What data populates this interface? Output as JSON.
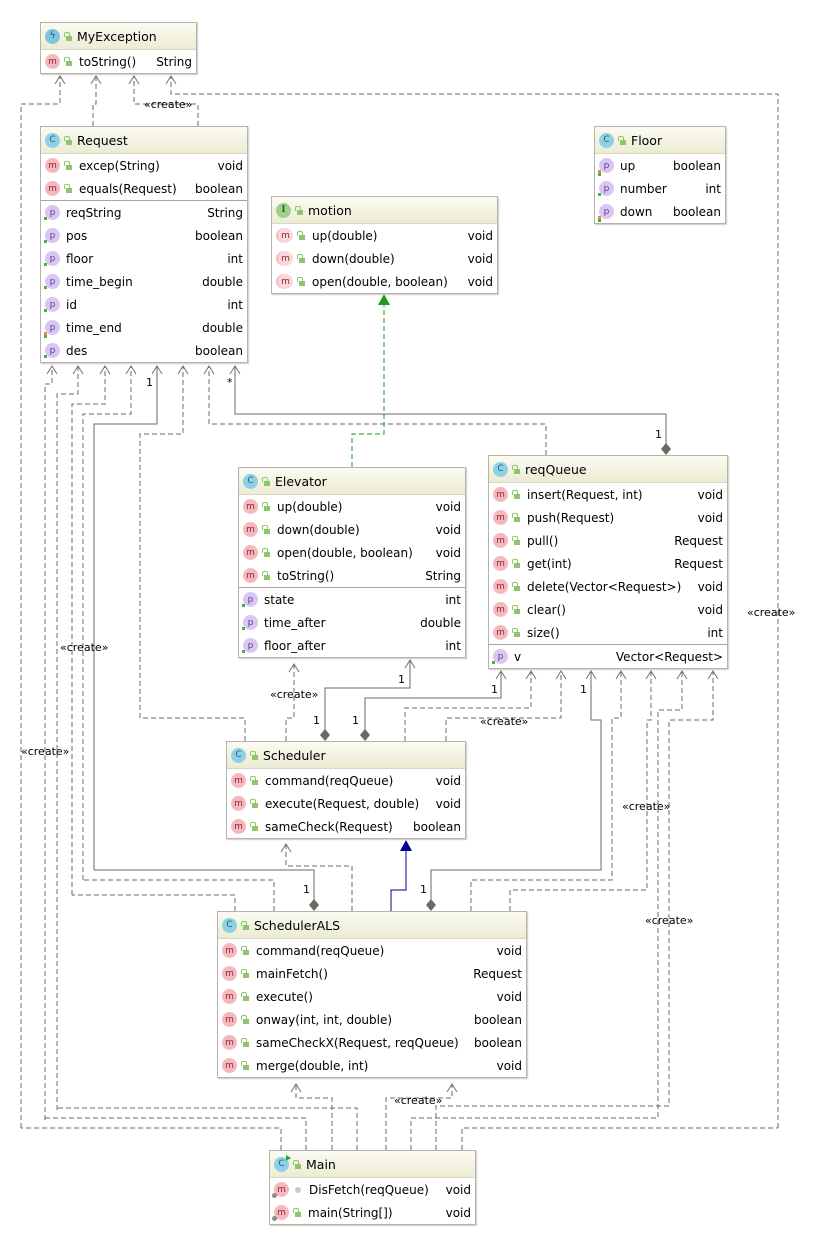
{
  "diagram": {
    "type": "UML class diagram",
    "classes": {
      "myexception": {
        "name": "MyException",
        "kind": "exception",
        "methods": [
          {
            "name": "toString()",
            "type": "String"
          }
        ]
      },
      "request": {
        "name": "Request",
        "kind": "class",
        "methods": [
          {
            "name": "excep(String)",
            "type": "void"
          },
          {
            "name": "equals(Request)",
            "type": "boolean"
          }
        ],
        "fields": [
          {
            "name": "reqString",
            "type": "String"
          },
          {
            "name": "pos",
            "type": "boolean"
          },
          {
            "name": "floor",
            "type": "int"
          },
          {
            "name": "time_begin",
            "type": "double"
          },
          {
            "name": "id",
            "type": "int"
          },
          {
            "name": "time_end",
            "type": "double"
          },
          {
            "name": "des",
            "type": "boolean"
          }
        ]
      },
      "floor": {
        "name": "Floor",
        "kind": "class",
        "fields": [
          {
            "name": "up",
            "type": "boolean"
          },
          {
            "name": "number",
            "type": "int"
          },
          {
            "name": "down",
            "type": "boolean"
          }
        ]
      },
      "motion": {
        "name": "motion",
        "kind": "interface",
        "methods": [
          {
            "name": "up(double)",
            "type": "void"
          },
          {
            "name": "down(double)",
            "type": "void"
          },
          {
            "name": "open(double, boolean)",
            "type": "void"
          }
        ]
      },
      "elevator": {
        "name": "Elevator",
        "kind": "class",
        "methods": [
          {
            "name": "up(double)",
            "type": "void"
          },
          {
            "name": "down(double)",
            "type": "void"
          },
          {
            "name": "open(double, boolean)",
            "type": "void"
          },
          {
            "name": "toString()",
            "type": "String"
          }
        ],
        "fields": [
          {
            "name": "state",
            "type": "int"
          },
          {
            "name": "time_after",
            "type": "double"
          },
          {
            "name": "floor_after",
            "type": "int"
          }
        ]
      },
      "reqqueue": {
        "name": "reqQueue",
        "kind": "class",
        "methods": [
          {
            "name": "insert(Request, int)",
            "type": "void"
          },
          {
            "name": "push(Request)",
            "type": "void"
          },
          {
            "name": "pull()",
            "type": "Request"
          },
          {
            "name": "get(int)",
            "type": "Request"
          },
          {
            "name": "delete(Vector<Request>)",
            "type": "void"
          },
          {
            "name": "clear()",
            "type": "void"
          },
          {
            "name": "size()",
            "type": "int"
          }
        ],
        "fields": [
          {
            "name": "v",
            "type": "Vector<Request>"
          }
        ]
      },
      "scheduler": {
        "name": "Scheduler",
        "kind": "class",
        "methods": [
          {
            "name": "command(reqQueue)",
            "type": "void"
          },
          {
            "name": "execute(Request, double)",
            "type": "void"
          },
          {
            "name": "sameCheck(Request)",
            "type": "boolean"
          }
        ]
      },
      "schedulerals": {
        "name": "SchedulerALS",
        "kind": "class",
        "methods": [
          {
            "name": "command(reqQueue)",
            "type": "void"
          },
          {
            "name": "mainFetch()",
            "type": "Request"
          },
          {
            "name": "execute()",
            "type": "void"
          },
          {
            "name": "onway(int, int, double)",
            "type": "boolean"
          },
          {
            "name": "sameCheckX(Request, reqQueue)",
            "type": "boolean"
          },
          {
            "name": "merge(double, int)",
            "type": "void"
          }
        ]
      },
      "main": {
        "name": "Main",
        "kind": "main-class",
        "methods": [
          {
            "name": "DisFetch(reqQueue)",
            "type": "void"
          },
          {
            "name": "main(String[])",
            "type": "void"
          }
        ]
      }
    },
    "labels": {
      "create": "«create»",
      "one": "1",
      "many": "*"
    },
    "icons": {
      "class": "C",
      "interface": "I",
      "method": "m",
      "property": "p",
      "exception": "ϟ"
    },
    "colors": {
      "realization": "#1f9a1f",
      "inheritance": "#00008b",
      "dependency": "#6e6862",
      "header": "#ecebd4"
    }
  }
}
